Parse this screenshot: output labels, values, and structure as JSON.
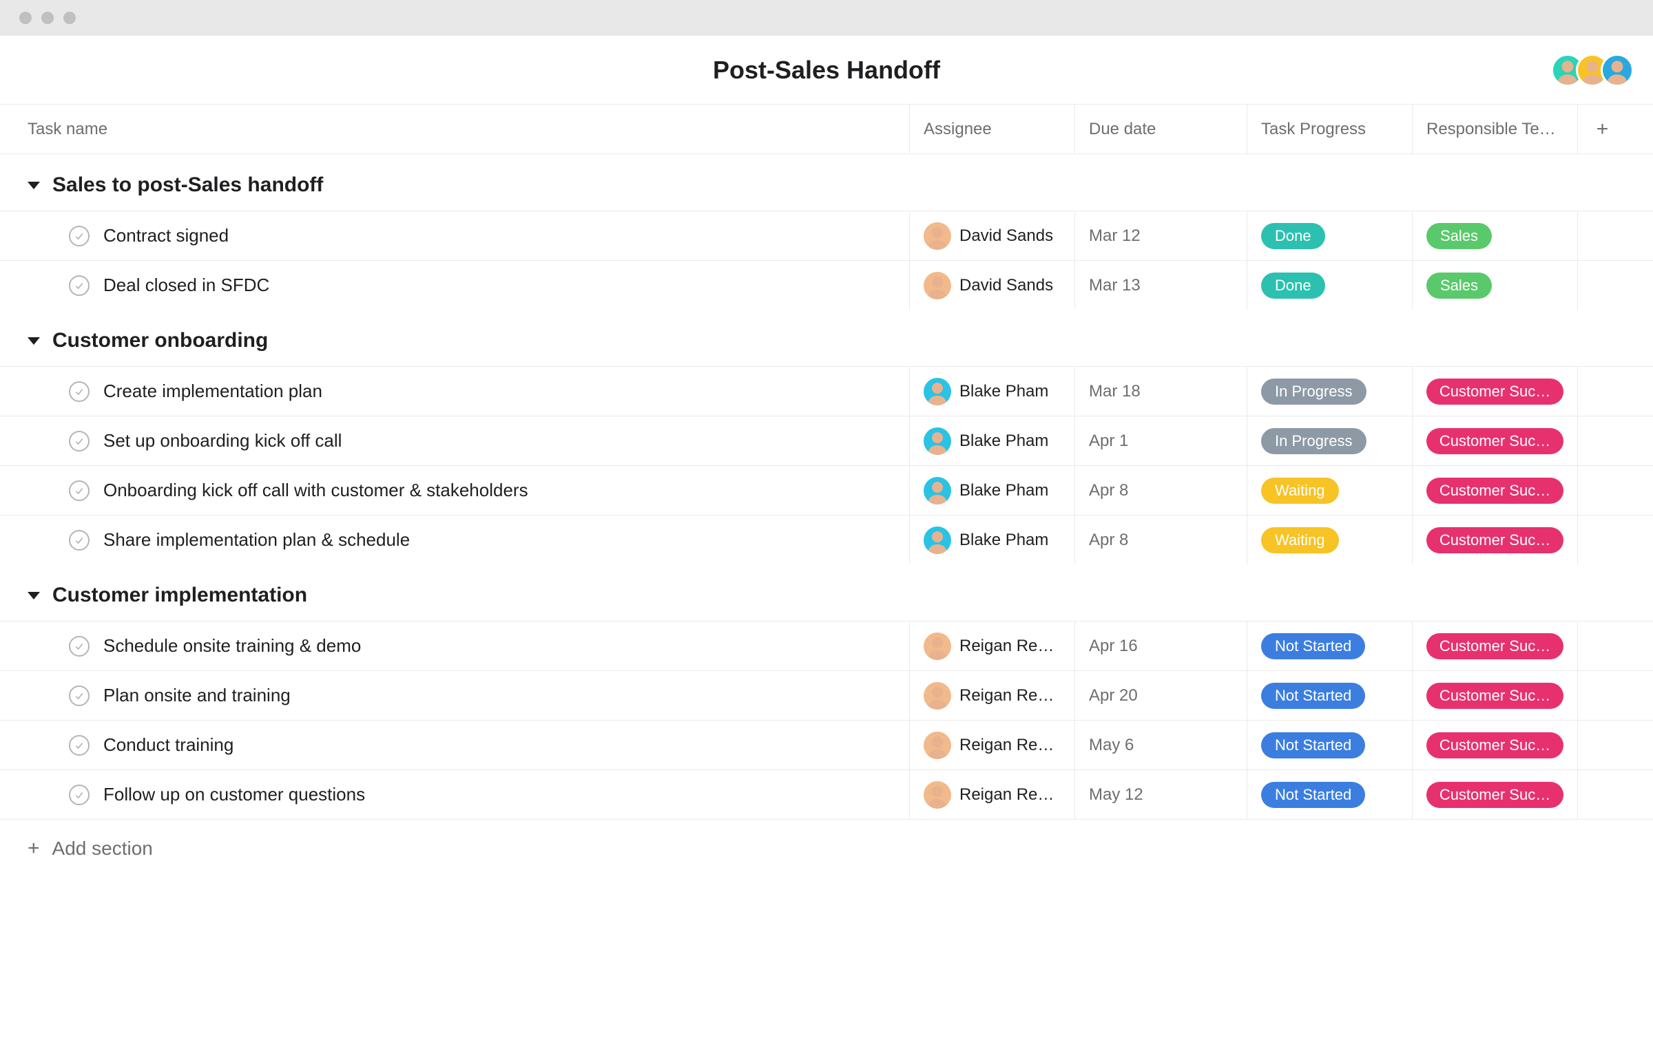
{
  "pageTitle": "Post-Sales Handoff",
  "columns": {
    "task": "Task name",
    "assignee": "Assignee",
    "due": "Due date",
    "progress": "Task Progress",
    "team": "Responsible Te…"
  },
  "addSectionLabel": "Add section",
  "collaborators": [
    {
      "bg": "#2bd4b8"
    },
    {
      "bg": "#f7c325"
    },
    {
      "bg": "#2aa9e0"
    }
  ],
  "progressColors": {
    "Done": "done",
    "In Progress": "inprog",
    "Waiting": "waiting",
    "Not Started": "notstart"
  },
  "teamColors": {
    "Sales": "sales",
    "Customer Suc…": "csuc"
  },
  "assigneeColors": {
    "David Sands": "#f2b98a",
    "Blake Pham": "#29c3e5",
    "Reigan Rea…": "#f2b98a"
  },
  "sections": [
    {
      "title": "Sales to post-Sales handoff",
      "tasks": [
        {
          "name": "Contract signed",
          "assignee": "David Sands",
          "due": "Mar 12",
          "progress": "Done",
          "team": "Sales"
        },
        {
          "name": "Deal closed in SFDC",
          "assignee": "David Sands",
          "due": "Mar 13",
          "progress": "Done",
          "team": "Sales"
        }
      ]
    },
    {
      "title": "Customer onboarding",
      "tasks": [
        {
          "name": "Create implementation plan",
          "assignee": "Blake Pham",
          "due": "Mar 18",
          "progress": "In Progress",
          "team": "Customer Suc…"
        },
        {
          "name": "Set up onboarding kick off call",
          "assignee": "Blake Pham",
          "due": "Apr 1",
          "progress": "In Progress",
          "team": "Customer Suc…"
        },
        {
          "name": "Onboarding kick off call with customer & stakeholders",
          "assignee": "Blake Pham",
          "due": "Apr 8",
          "progress": "Waiting",
          "team": "Customer Suc…"
        },
        {
          "name": "Share implementation plan & schedule",
          "assignee": "Blake Pham",
          "due": "Apr 8",
          "progress": "Waiting",
          "team": "Customer Suc…"
        }
      ]
    },
    {
      "title": "Customer implementation",
      "tasks": [
        {
          "name": "Schedule onsite training & demo",
          "assignee": "Reigan Rea…",
          "due": "Apr 16",
          "progress": "Not Started",
          "team": "Customer Suc…"
        },
        {
          "name": "Plan onsite and training",
          "assignee": "Reigan Rea…",
          "due": "Apr 20",
          "progress": "Not Started",
          "team": "Customer Suc…"
        },
        {
          "name": "Conduct training",
          "assignee": "Reigan Rea…",
          "due": "May 6",
          "progress": "Not Started",
          "team": "Customer Suc…"
        },
        {
          "name": "Follow up on customer questions",
          "assignee": "Reigan Rea…",
          "due": "May 12",
          "progress": "Not Started",
          "team": "Customer Suc…"
        }
      ]
    }
  ]
}
